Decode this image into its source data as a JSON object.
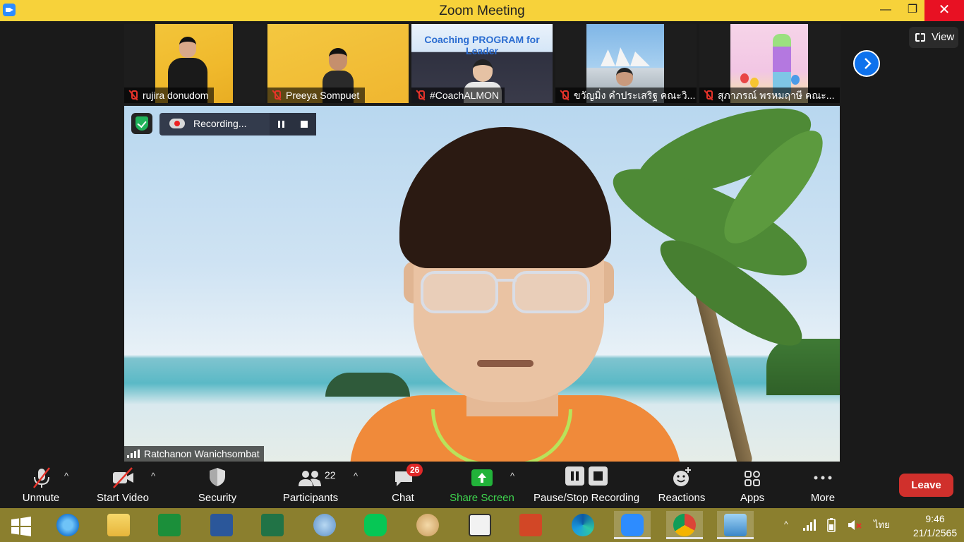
{
  "window": {
    "title": "Zoom Meeting",
    "minimize": "—",
    "maximize": "❐",
    "close": "✕"
  },
  "view_button": {
    "label": "View"
  },
  "thumbnails": [
    {
      "name": "rujira donudom"
    },
    {
      "name": "Preeya Sompuet"
    },
    {
      "name": "#CoachALMON"
    },
    {
      "name": "ขวัญมิ่ง คำประเสริฐ คณะวิ..."
    },
    {
      "name": "สุภาภรณ์ พรหมฤาษี คณะ..."
    }
  ],
  "thumbnail_art": {
    "coaching_banner": "Coaching PROGRAM for Leader"
  },
  "recording": {
    "label": "Recording..."
  },
  "main_speaker": {
    "name": "Ratchanon Wanichsombat"
  },
  "toolbar": {
    "unmute": "Unmute",
    "start_video": "Start Video",
    "security": "Security",
    "participants": "Participants",
    "participants_count": "22",
    "chat": "Chat",
    "chat_badge": "26",
    "share_screen": "Share Screen",
    "pause_stop_recording": "Pause/Stop Recording",
    "reactions": "Reactions",
    "apps": "Apps",
    "more": "More",
    "leave": "Leave"
  },
  "taskbar": {
    "apps": [
      "start",
      "internet-explorer",
      "file-explorer",
      "store",
      "word",
      "excel",
      "calculator-math",
      "line",
      "paint",
      "lisrel",
      "powerpoint",
      "edge",
      "zoom",
      "chrome",
      "remote-desktop"
    ],
    "language": "ไทย",
    "time": "9:46",
    "date": "21/1/2565"
  },
  "colors": {
    "titlebar": "#f7d23a",
    "leave": "#d0302c",
    "share": "#3ed44e",
    "taskbar": "#8b7f2e"
  }
}
